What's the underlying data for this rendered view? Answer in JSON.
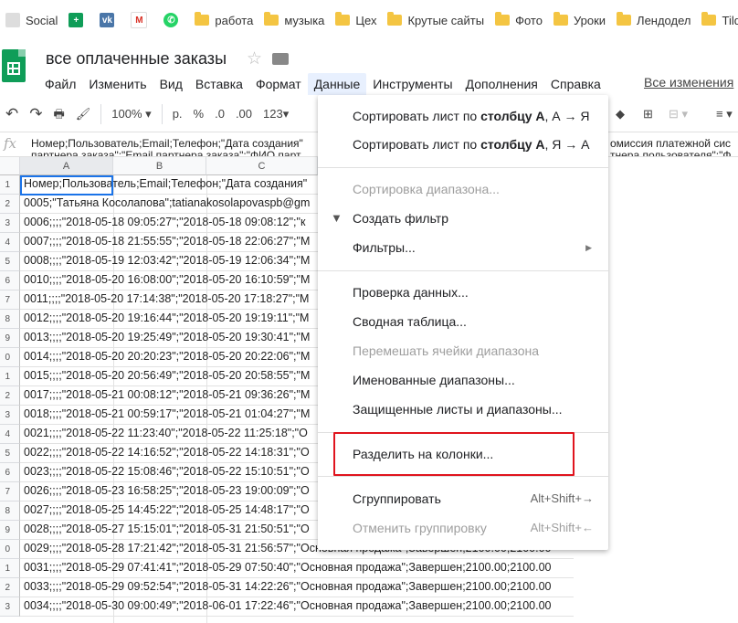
{
  "bookmarks": [
    {
      "label": "Social",
      "icon": "social-icon"
    },
    {
      "label": "",
      "icon": "google-sheets-icon"
    },
    {
      "label": "",
      "icon": "vk-icon"
    },
    {
      "label": "",
      "icon": "gmail-icon"
    },
    {
      "label": "",
      "icon": "whatsapp-icon"
    },
    {
      "label": "работа",
      "icon": "folder-icon"
    },
    {
      "label": "музыка",
      "icon": "folder-icon"
    },
    {
      "label": "Цех",
      "icon": "folder-icon"
    },
    {
      "label": "Крутые сайты",
      "icon": "folder-icon"
    },
    {
      "label": "Фото",
      "icon": "folder-icon"
    },
    {
      "label": "Уроки",
      "icon": "folder-icon"
    },
    {
      "label": "Лендодел",
      "icon": "folder-icon"
    },
    {
      "label": "Tild",
      "icon": "folder-icon"
    }
  ],
  "doc": {
    "title": "все оплаченные заказы",
    "last_edit": "Все изменения"
  },
  "menubar": [
    "Файл",
    "Изменить",
    "Вид",
    "Вставка",
    "Формат",
    "Данные",
    "Инструменты",
    "Дополнения",
    "Справка"
  ],
  "toolbar": {
    "zoom": "100%",
    "currency": "р.",
    "percent": "%",
    "dec_less": ".0",
    "dec_more": ".00",
    "format": "123"
  },
  "formula": {
    "fx": "fx",
    "line1": "Номер;Пользователь;Email;Телефон;\"Дата создания\"",
    "line1_right": "омиссия платежной сис",
    "line2": "партнера заказа\";\"Email партнера заказа\";\"ФИО парт",
    "line2_right": "тнера пользователя\";\"Ф"
  },
  "columns": [
    "A",
    "B",
    "C"
  ],
  "rows": [
    {
      "n": "1",
      "text": "Номер;Пользователь;Email;Телефон;\"Дата создания\""
    },
    {
      "n": "2",
      "text": "0005;\"Татьяна Косолапова\";tatianakosolapovaspb@gm"
    },
    {
      "n": "3",
      "text": "0006;;;;\"2018-05-18 09:05:27\";\"2018-05-18 09:08:12\";\"к"
    },
    {
      "n": "4",
      "text": "0007;;;;\"2018-05-18 21:55:55\";\"2018-05-18 22:06:27\";\"М"
    },
    {
      "n": "5",
      "text": "0008;;;;\"2018-05-19 12:03:42\";\"2018-05-19 12:06:34\";\"М"
    },
    {
      "n": "6",
      "text": "0010;;;;\"2018-05-20 16:08:00\";\"2018-05-20 16:10:59\";\"М"
    },
    {
      "n": "7",
      "text": "0011;;;;\"2018-05-20 17:14:38\";\"2018-05-20 17:18:27\";\"М"
    },
    {
      "n": "8",
      "text": "0012;;;;\"2018-05-20 19:16:44\";\"2018-05-20 19:19:11\";\"М"
    },
    {
      "n": "9",
      "text": "0013;;;;\"2018-05-20 19:25:49\";\"2018-05-20 19:30:41\";\"М"
    },
    {
      "n": "0",
      "text": "0014;;;;\"2018-05-20 20:20:23\";\"2018-05-20 20:22:06\";\"М"
    },
    {
      "n": "1",
      "text": "0015;;;;\"2018-05-20 20:56:49\";\"2018-05-20 20:58:55\";\"М"
    },
    {
      "n": "2",
      "text": "0017;;;;\"2018-05-21 00:08:12\";\"2018-05-21 09:36:26\";\"М"
    },
    {
      "n": "3",
      "text": "0018;;;;\"2018-05-21 00:59:17\";\"2018-05-21 01:04:27\";\"М"
    },
    {
      "n": "4",
      "text": "0021;;;;\"2018-05-22 11:23:40\";\"2018-05-22 11:25:18\";\"О"
    },
    {
      "n": "5",
      "text": "0022;;;;\"2018-05-22 14:16:52\";\"2018-05-22 14:18:31\";\"О"
    },
    {
      "n": "6",
      "text": "0023;;;;\"2018-05-22 15:08:46\";\"2018-05-22 15:10:51\";\"О"
    },
    {
      "n": "7",
      "text": "0026;;;;\"2018-05-23 16:58:25\";\"2018-05-23 19:00:09\";\"О"
    },
    {
      "n": "8",
      "text": "0027;;;;\"2018-05-25 14:45:22\";\"2018-05-25 14:48:17\";\"О"
    },
    {
      "n": "9",
      "text": "0028;;;;\"2018-05-27 15:15:01\";\"2018-05-31 21:50:51\";\"О"
    },
    {
      "n": "0",
      "text": "0029;;;;\"2018-05-28 17:21:42\";\"2018-05-31 21:56:57\";\"Основная продажа\";Завершен;2100.00;2100.00"
    },
    {
      "n": "1",
      "text": "0031;;;;\"2018-05-29 07:41:41\";\"2018-05-29 07:50:40\";\"Основная продажа\";Завершен;2100.00;2100.00"
    },
    {
      "n": "2",
      "text": "0033;;;;\"2018-05-29 09:52:54\";\"2018-05-31 14:22:26\";\"Основная продажа\";Завершен;2100.00;2100.00"
    },
    {
      "n": "3",
      "text": "0034;;;;\"2018-05-30 09:00:49\";\"2018-06-01 17:22:46\";\"Основная продажа\";Завершен;2100.00;2100.00"
    }
  ],
  "menu": {
    "sort_az_prefix": "Сортировать лист по ",
    "sort_col": "столбцу A",
    "sort_az_suffix": ", А → Я",
    "sort_za_suffix": ", Я → А",
    "sort_range": "Сортировка диапазона...",
    "create_filter": "Создать фильтр",
    "filters": "Фильтры...",
    "validation": "Проверка данных...",
    "pivot": "Сводная таблица...",
    "shuffle": "Перемешать ячейки диапазона",
    "named_ranges": "Именованные диапазоны...",
    "protected": "Защищенные листы и диапазоны...",
    "split": "Разделить на колонки...",
    "group": "Сгруппировать",
    "group_shortcut": "Alt+Shift+→",
    "ungroup": "Отменить группировку",
    "ungroup_shortcut": "Alt+Shift+←"
  },
  "colors": {
    "highlight": "#e0141e",
    "selection": "#1a73e8",
    "sheets_green": "#0f9d58"
  }
}
